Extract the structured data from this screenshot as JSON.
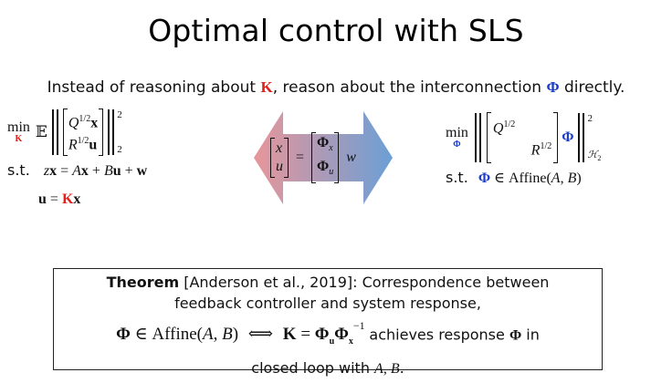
{
  "slide": {
    "title": "Optimal control with SLS",
    "subtitle": {
      "before": "Instead of reasoning about ",
      "K": "K",
      "middle": ", reason about the interconnection ",
      "Phi": "Φ",
      "after": " directly."
    }
  },
  "left_problem": {
    "min": "min",
    "min_var": "K",
    "expect": "𝔼",
    "row1": "Q",
    "row1_sup": "1/2",
    "row1_var": "x",
    "row2": "R",
    "row2_sup": "1/2",
    "row2_var": "u",
    "norm_sup": "2",
    "norm_sub": "2",
    "st": "s.t.",
    "constraint1": {
      "z": "z",
      "x": "x",
      "eq": " = ",
      "A": "A",
      "x2": "x",
      "plus1": " + ",
      "B": "B",
      "u": "u",
      "plus2": " + ",
      "w": "w"
    },
    "constraint2": {
      "u": "u",
      "eq": " = ",
      "K": "K",
      "x": "x"
    }
  },
  "arrow": {
    "left_vec": [
      "x",
      "u"
    ],
    "eq": "=",
    "phi_x": "Φ",
    "phi_x_sub": "x",
    "phi_u": "Φ",
    "phi_u_sub": "u",
    "w": "w",
    "colors": {
      "left": "#e8969a",
      "right": "#6b9fd6"
    }
  },
  "right_problem": {
    "min": "min",
    "min_var": "Φ",
    "Q": "Q",
    "Q_sup": "1/2",
    "R": "R",
    "R_sup": "1/2",
    "Phi": "Φ",
    "norm_sup": "2",
    "norm_sub": "ℋ",
    "norm_sub2": "2",
    "st": "s.t.",
    "constraint_phi": "Φ",
    "constraint_rest": " ∈ Affine(",
    "A": "A",
    "comma": ", ",
    "B": "B",
    "close": ")"
  },
  "theorem": {
    "label": "Theorem",
    "citation": " [Anderson et al., 2019]: Correspondence between",
    "line2": "feedback controller and system response,",
    "phi": "Φ",
    "in_affine": " ∈ Affine(",
    "A": "A",
    "comma": ", ",
    "B": "B",
    "close": ")",
    "iff": "⟺",
    "K": "K",
    "eq": " = ",
    "phi_u": "Φ",
    "phi_u_sub": "u",
    "phi_x": "Φ",
    "phi_x_sub": "x",
    "inv": "−1",
    "achieves": " achieves response ",
    "phi2": "Φ",
    "in": " in",
    "line4_before": "closed loop with ",
    "line4_A": "A",
    "line4_comma": ", ",
    "line4_B": "B",
    "line4_after": "."
  }
}
